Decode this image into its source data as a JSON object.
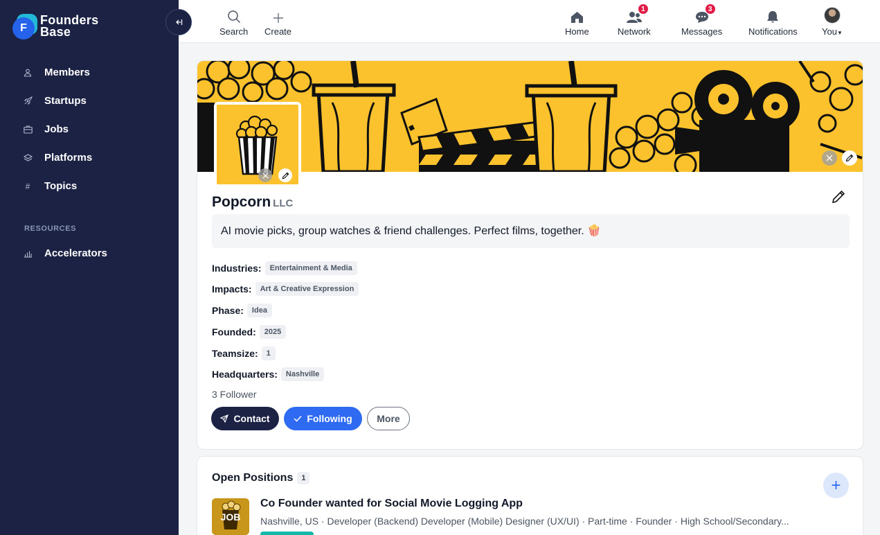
{
  "brand": {
    "line1": "Founders",
    "line2": "Base",
    "mark_letter": "F"
  },
  "sidebar": {
    "items": [
      {
        "label": "Members",
        "icon": "user-icon"
      },
      {
        "label": "Startups",
        "icon": "rocket-icon"
      },
      {
        "label": "Jobs",
        "icon": "briefcase-icon"
      },
      {
        "label": "Platforms",
        "icon": "layers-icon"
      },
      {
        "label": "Topics",
        "icon": "hash-icon"
      }
    ],
    "resources_heading": "RESOURCES",
    "resources_items": [
      {
        "label": "Accelerators",
        "icon": "bar-chart-icon"
      }
    ]
  },
  "topbar": {
    "search": "Search",
    "create": "Create",
    "home": "Home",
    "network": "Network",
    "network_badge": "1",
    "messages": "Messages",
    "messages_badge": "3",
    "notifications": "Notifications",
    "you": "You"
  },
  "company": {
    "name": "Popcorn",
    "suffix": "LLC",
    "tagline": "AI movie picks, group watches & friend challenges. Perfect films, together. 🍿",
    "attributes": [
      {
        "label": "Industries:",
        "value": "Entertainment & Media"
      },
      {
        "label": "Impacts:",
        "value": "Art & Creative Expression"
      },
      {
        "label": "Phase:",
        "value": "Idea"
      },
      {
        "label": "Founded:",
        "value": "2025"
      },
      {
        "label": "Teamsize:",
        "value": "1"
      },
      {
        "label": "Headquarters:",
        "value": "Nashville"
      }
    ],
    "followers": "3 Follower",
    "buttons": {
      "contact": "Contact",
      "following": "Following",
      "more": "More"
    }
  },
  "positions": {
    "title": "Open Positions",
    "count": "1",
    "job": {
      "thumb_label": "JOB",
      "title": "Co Founder wanted for Social Movie Logging App",
      "meta": "Nashville, US · Developer (Backend) Developer (Mobile) Designer (UX/UI) · Part-time · Founder · High School/Secondary..."
    }
  },
  "colors": {
    "sidebar": "#1b2244",
    "accent": "#2f6bf2",
    "banner": "#fbc22d",
    "badge": "#e11d48"
  }
}
